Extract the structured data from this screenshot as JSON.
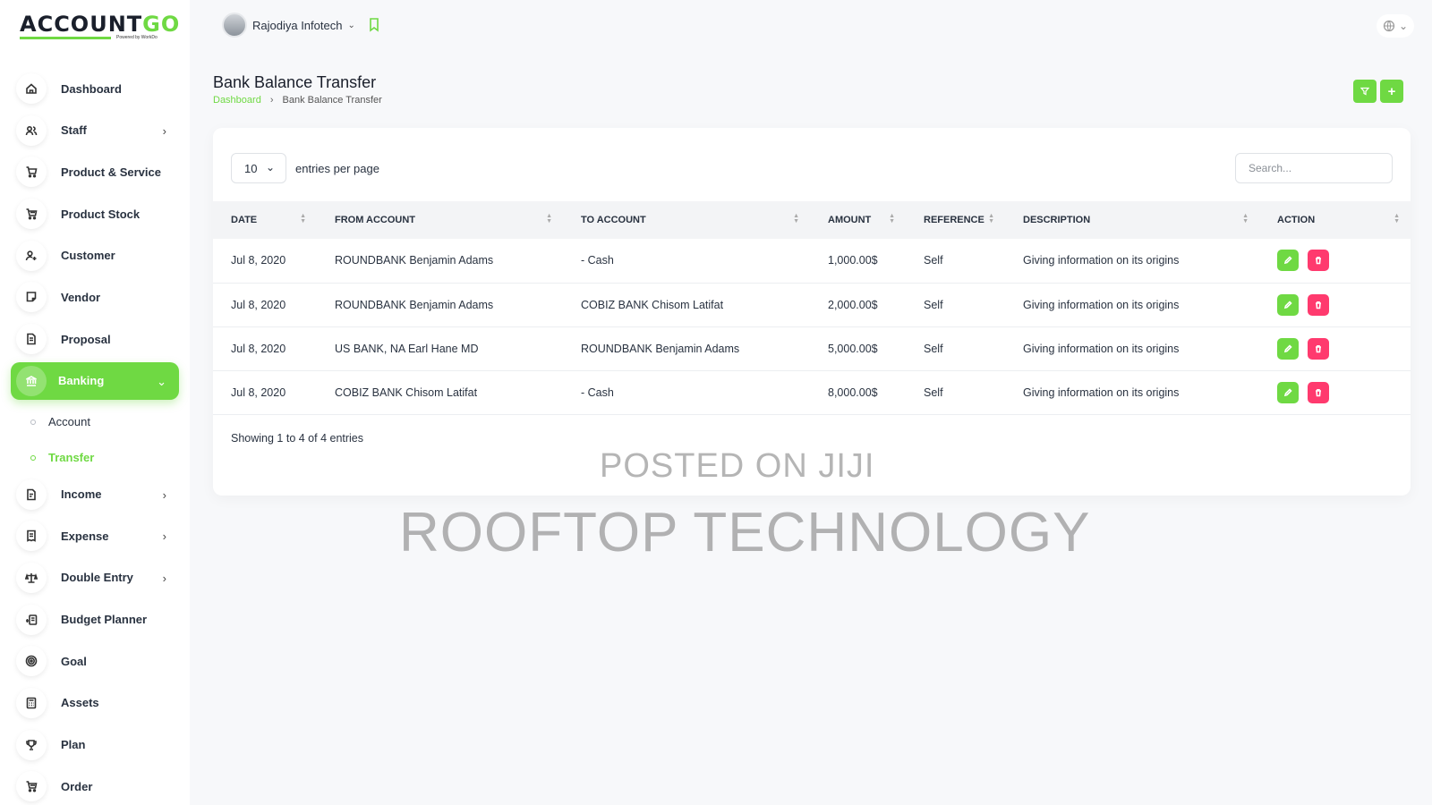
{
  "app": {
    "logo_main": "ACCOUNT",
    "logo_accent": "GO",
    "logo_tagline": "Powered by WorkDo",
    "accent_color": "#6fd943",
    "danger_color": "#ff3a6e"
  },
  "topbar": {
    "user_name": "Rajodiya Infotech",
    "caret": "⌄",
    "lang_icon": "globe-icon"
  },
  "sidebar": {
    "items": [
      {
        "label": "Dashboard",
        "icon": "home-icon",
        "chev": ""
      },
      {
        "label": "Staff",
        "icon": "users-icon",
        "chev": "›"
      },
      {
        "label": "Product & Service",
        "icon": "cart-icon",
        "chev": ""
      },
      {
        "label": "Product Stock",
        "icon": "cart-stock-icon",
        "chev": ""
      },
      {
        "label": "Customer",
        "icon": "user-plus-icon",
        "chev": ""
      },
      {
        "label": "Vendor",
        "icon": "note-icon",
        "chev": ""
      },
      {
        "label": "Proposal",
        "icon": "file-icon",
        "chev": ""
      },
      {
        "label": "Banking",
        "icon": "bank-icon",
        "chev": "⌄"
      }
    ],
    "sub_items": [
      {
        "label": "Account"
      },
      {
        "label": "Transfer"
      }
    ],
    "items_after": [
      {
        "label": "Income",
        "icon": "invoice-icon",
        "chev": "›"
      },
      {
        "label": "Expense",
        "icon": "receipt-icon",
        "chev": "›"
      },
      {
        "label": "Double Entry",
        "icon": "scale-icon",
        "chev": "›"
      },
      {
        "label": "Budget Planner",
        "icon": "budget-icon",
        "chev": ""
      },
      {
        "label": "Goal",
        "icon": "target-icon",
        "chev": ""
      },
      {
        "label": "Assets",
        "icon": "calculator-icon",
        "chev": ""
      },
      {
        "label": "Plan",
        "icon": "trophy-icon",
        "chev": ""
      },
      {
        "label": "Order",
        "icon": "order-icon",
        "chev": ""
      }
    ]
  },
  "page": {
    "title": "Bank Balance Transfer",
    "breadcrumb_home": "Dashboard",
    "breadcrumb_sep": "›",
    "breadcrumb_current": "Bank Balance Transfer",
    "filter_label": "▾",
    "add_label": "+"
  },
  "table": {
    "per_page_value": "10",
    "per_page_caret": "⌄",
    "per_page_label": "entries per page",
    "search_placeholder": "Search...",
    "headers": [
      "DATE",
      "FROM ACCOUNT",
      "TO ACCOUNT",
      "AMOUNT",
      "REFERENCE",
      "DESCRIPTION",
      "ACTION"
    ],
    "rows": [
      {
        "date": "Jul 8, 2020",
        "from": "ROUNDBANK Benjamin Adams",
        "to": "- Cash",
        "amount": "1,000.00$",
        "reference": "Self",
        "description": "Giving information on its origins"
      },
      {
        "date": "Jul 8, 2020",
        "from": "ROUNDBANK Benjamin Adams",
        "to": "COBIZ BANK Chisom Latifat",
        "amount": "2,000.00$",
        "reference": "Self",
        "description": "Giving information on its origins"
      },
      {
        "date": "Jul 8, 2020",
        "from": "US BANK, NA Earl Hane MD",
        "to": "ROUNDBANK Benjamin Adams",
        "amount": "5,000.00$",
        "reference": "Self",
        "description": "Giving information on its origins"
      },
      {
        "date": "Jul 8, 2020",
        "from": "COBIZ BANK Chisom Latifat",
        "to": "- Cash",
        "amount": "8,000.00$",
        "reference": "Self",
        "description": "Giving information on its origins"
      }
    ],
    "showing": "Showing 1 to 4 of 4 entries"
  },
  "watermark": {
    "line1": "POSTED ON JIJI",
    "line2": "ROOFTOP TECHNOLOGY"
  }
}
